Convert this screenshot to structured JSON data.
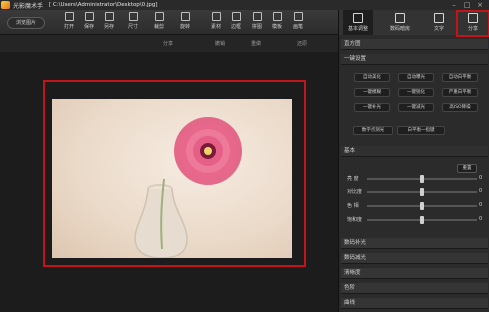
{
  "titlebar": {
    "app_title": "光影魔术手",
    "path": "[ C:\\Users\\Administrator\\Desktop\\0.jpg]",
    "controls": [
      "–",
      "□",
      "×"
    ]
  },
  "toolbar": {
    "browse": "浏览图片",
    "tools": [
      "打开",
      "保存",
      "另存",
      "尺寸",
      "裁剪",
      "旋转",
      "素材",
      "边框",
      "拼图",
      "模板",
      "画笔"
    ]
  },
  "subbar": {
    "items": [
      "分享",
      "撤销",
      "重做",
      "还原"
    ]
  },
  "panel": {
    "tabs": [
      "基本调整",
      "数码暗房",
      "文字"
    ],
    "share_label": "分享",
    "sections": {
      "histogram": "直方图",
      "oneclick": "一键设置",
      "basic": "基本",
      "digital_fill": "数码补光",
      "digital_reduce": "数码减光",
      "clarity": "清晰度",
      "levels": "色阶",
      "curves": "曲线"
    },
    "oneclick_buttons": [
      [
        "自动美化",
        "自动曝光",
        "自动白平衡"
      ],
      [
        "一键模糊",
        "一键锐化",
        "严重白平衡"
      ],
      [
        "一键补光",
        "一键减光",
        "高ISO降噪"
      ]
    ],
    "wide_buttons": [
      "数字点测光",
      "白平衡一指键"
    ],
    "reset": "重置",
    "sliders": [
      {
        "label": "亮  度",
        "value": 0,
        "pos": 0.5
      },
      {
        "label": "对比度",
        "value": 0,
        "pos": 0.5
      },
      {
        "label": "色  相",
        "value": 0,
        "pos": 0.5
      },
      {
        "label": "饱和度",
        "value": 0,
        "pos": 0.5
      }
    ]
  },
  "colors": {
    "highlight": "#c4141a",
    "flower": "#e0517a"
  }
}
